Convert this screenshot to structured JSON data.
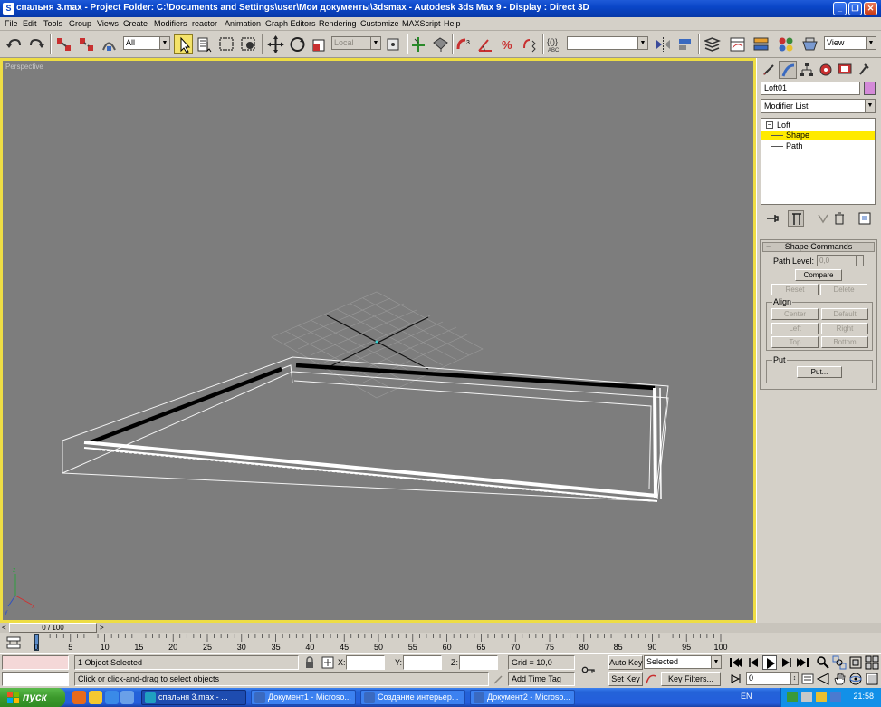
{
  "window": {
    "title": "спальня 3.max      - Project Folder: C:\\Documents and Settings\\user\\Мои документы\\3dsmax      - Autodesk 3ds Max 9      - Display : Direct 3D"
  },
  "menu": [
    "File",
    "Edit",
    "Tools",
    "Group",
    "Views",
    "Create",
    "Modifiers",
    "reactor",
    "Animation",
    "Graph Editors",
    "Rendering",
    "Customize",
    "MAXScript",
    "Help"
  ],
  "toolbar": {
    "selection_filter": "All",
    "ref_coord": "Local",
    "named_selection": "",
    "render_view": "View"
  },
  "viewport": {
    "label": "Perspective"
  },
  "command_panel": {
    "object_name": "Loft01",
    "object_color": "#d48ad8",
    "modifier_list": "Modifier List",
    "stack": [
      {
        "label": "Loft",
        "expanded": true
      },
      {
        "label": "Shape",
        "selected": true
      },
      {
        "label": "Path"
      }
    ],
    "rollout": {
      "title": "Shape Commands",
      "path_level_label": "Path Level:",
      "path_level_value": "0,0",
      "compare": "Compare",
      "reset": "Reset",
      "delete": "Delete",
      "align_title": "Align",
      "center": "Center",
      "default": "Default",
      "left": "Left",
      "right": "Right",
      "top": "Top",
      "bottom": "Bottom",
      "put_title": "Put",
      "put": "Put..."
    }
  },
  "timeslider": {
    "position": "0 / 100",
    "frame": 0,
    "total": 100
  },
  "trackbar": {
    "ticks": [
      "0",
      "5",
      "10",
      "15",
      "20",
      "25",
      "30",
      "35",
      "40",
      "45",
      "50",
      "55",
      "60",
      "65",
      "70",
      "75",
      "80",
      "85",
      "90",
      "95",
      "100"
    ]
  },
  "status": {
    "selection": "1 Object Selected",
    "prompt": "Click or click-and-drag to select objects",
    "x_label": "X:",
    "y_label": "Y:",
    "z_label": "Z:",
    "x_value": "",
    "y_value": "",
    "z_value": "",
    "grid": "Grid = 10,0",
    "add_time_tag": "Add Time Tag",
    "auto_key": "Auto Key",
    "set_key": "Set Key",
    "key_mode": "Selected",
    "key_filters": "Key Filters...",
    "current_frame": "0"
  },
  "taskbar": {
    "start": "пуск",
    "tasks": [
      {
        "label": "спальня 3.max   - ...",
        "active": true
      },
      {
        "label": "Документ1 - Microso..."
      },
      {
        "label": "Создание интерьер..."
      },
      {
        "label": "Документ2 - Microso..."
      }
    ],
    "lang": "EN",
    "clock": "21:58"
  }
}
